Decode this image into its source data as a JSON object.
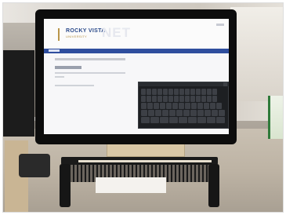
{
  "site": {
    "logo_name": "ROCKY VISTA",
    "logo_sub": "UNIVERSITY",
    "logo_suffix": "NET"
  },
  "keyboard": {
    "rows": [
      14,
      14,
      13,
      12,
      9
    ]
  }
}
